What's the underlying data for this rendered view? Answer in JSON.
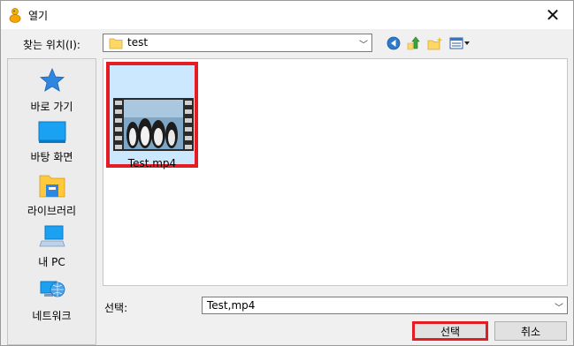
{
  "window": {
    "title": "열기"
  },
  "lookin": {
    "label": "찾는 위치(I):",
    "value": "test"
  },
  "places": [
    {
      "label": "바로 가기",
      "icon": "quick-access-star-icon"
    },
    {
      "label": "바탕 화면",
      "icon": "desktop-icon"
    },
    {
      "label": "라이브러리",
      "icon": "libraries-folder-icon"
    },
    {
      "label": "내 PC",
      "icon": "this-pc-icon"
    },
    {
      "label": "네트워크",
      "icon": "network-icon"
    }
  ],
  "files": [
    {
      "name": "Test.mp4",
      "type": "video",
      "selected": true
    }
  ],
  "selection": {
    "label": "선택:",
    "value": "Test,mp4"
  },
  "buttons": {
    "ok": "선택",
    "cancel": "취소"
  },
  "colors": {
    "highlight_border": "#e41c23",
    "selected_bg": "#cce8ff"
  }
}
